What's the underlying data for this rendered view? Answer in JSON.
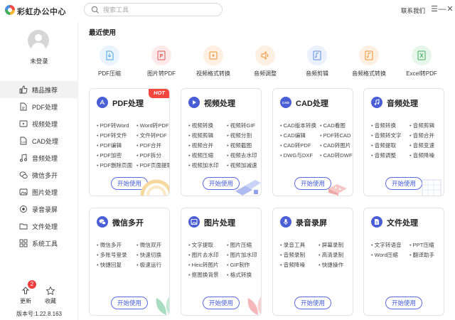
{
  "app": {
    "title": "彩虹办公中心",
    "search_placeholder": "搜索工具",
    "contact": "联系我们",
    "window_controls": [
      "☰",
      "—",
      "✕"
    ]
  },
  "sidebar": {
    "login_status": "未登录",
    "items": [
      {
        "label": "精品推荐",
        "icon": "thumbs-up-icon",
        "active": true
      },
      {
        "label": "PDF处理",
        "icon": "pdf-file-icon"
      },
      {
        "label": "视频处理",
        "icon": "video-icon"
      },
      {
        "label": "CAD处理",
        "icon": "cad-icon"
      },
      {
        "label": "音频处理",
        "icon": "music-icon"
      },
      {
        "label": "微信多开",
        "icon": "wechat-icon"
      },
      {
        "label": "图片处理",
        "icon": "image-icon"
      },
      {
        "label": "录音录屏",
        "icon": "record-icon"
      },
      {
        "label": "文件处理",
        "icon": "folder-icon"
      },
      {
        "label": "系统工具",
        "icon": "system-tool-icon"
      }
    ],
    "update_label": "更新",
    "update_badge": "2",
    "favorite_label": "收藏",
    "version": "版本号:1.22.8.163"
  },
  "main": {
    "recent_title": "最近使用",
    "recent": [
      {
        "label": "PDF压缩",
        "color": "#eaf4fc",
        "fg": "#4aa3df"
      },
      {
        "label": "图片转PDF",
        "color": "#fde9e9",
        "fg": "#e05252"
      },
      {
        "label": "视频格式转换",
        "color": "#fdf0e3",
        "fg": "#f0922e"
      },
      {
        "label": "音频调整",
        "color": "#fdf0e3",
        "fg": "#f0922e"
      },
      {
        "label": "音频剪辑",
        "color": "#eaf0fc",
        "fg": "#5b8ae0"
      },
      {
        "label": "音频格式转换",
        "color": "#fdf0e3",
        "fg": "#f0922e"
      },
      {
        "label": "Excel转PDF",
        "color": "#e7f6ea",
        "fg": "#3cae5c"
      }
    ],
    "cards": [
      {
        "title": "PDF处理",
        "hot": "HOT",
        "icon_color": "#4a5fd6",
        "features": [
          "PDF转Word",
          "Word转PDF",
          "PDF转文件",
          "文件转PDF",
          "PDF编辑",
          "PDF合并",
          "PDF加密",
          "PDF拆分",
          "PDF删除页面",
          "PDF页面提取"
        ],
        "button": "开始使用"
      },
      {
        "title": "视频处理",
        "icon_color": "#4a5fd6",
        "features": [
          "视频转换",
          "视频转GIF",
          "视频剪辑",
          "视频分割",
          "视频合并",
          "视频截图",
          "视频压缩",
          "视频去水印",
          "视频加水印",
          "视频加减速"
        ],
        "button": "开始使用"
      },
      {
        "title": "CAD处理",
        "icon_color": "#4a5fd6",
        "features": [
          "CAD版本转换",
          "CAD看图",
          "CAD编辑",
          "PDF转CAD",
          "CAD转PDF",
          "CAD转图片",
          "DWG与DXF",
          "CAD转DWF"
        ],
        "button": "开始使用"
      },
      {
        "title": "音频处理",
        "icon_color": "#4a5fd6",
        "features": [
          "音频转换",
          "音频剪辑",
          "音频转文字",
          "音频合并",
          "音频提取",
          "音频变速",
          "音频调整",
          "音频降噪"
        ],
        "button": "开始使用"
      },
      {
        "title": "微信多开",
        "icon_color": "#4a5fd6",
        "features": [
          "微信多开",
          "微信双开",
          "多账号登录",
          "快速切换",
          "快捷回复",
          "极速运行"
        ],
        "button": "开始使用"
      },
      {
        "title": "图片处理",
        "icon_color": "#4a5fd6",
        "features": [
          "文字提取",
          "图片压缩",
          "图片去水印",
          "图片加水印",
          "Heic转图片",
          "GIF制作",
          "抠图换背景",
          "格式转换"
        ],
        "button": "开始使用"
      },
      {
        "title": "录音录屏",
        "icon_color": "#4a5fd6",
        "features": [
          "录音工具",
          "屏幕录制",
          "音频录制",
          "高清录制",
          "音频降噪",
          "快捷操作"
        ],
        "button": "开始使用"
      },
      {
        "title": "文件处理",
        "icon_color": "#4a5fd6",
        "features": [
          "文字转语音",
          "PPT压缩",
          "Word压缩",
          "翻译助手"
        ],
        "button": "开始使用"
      }
    ]
  }
}
